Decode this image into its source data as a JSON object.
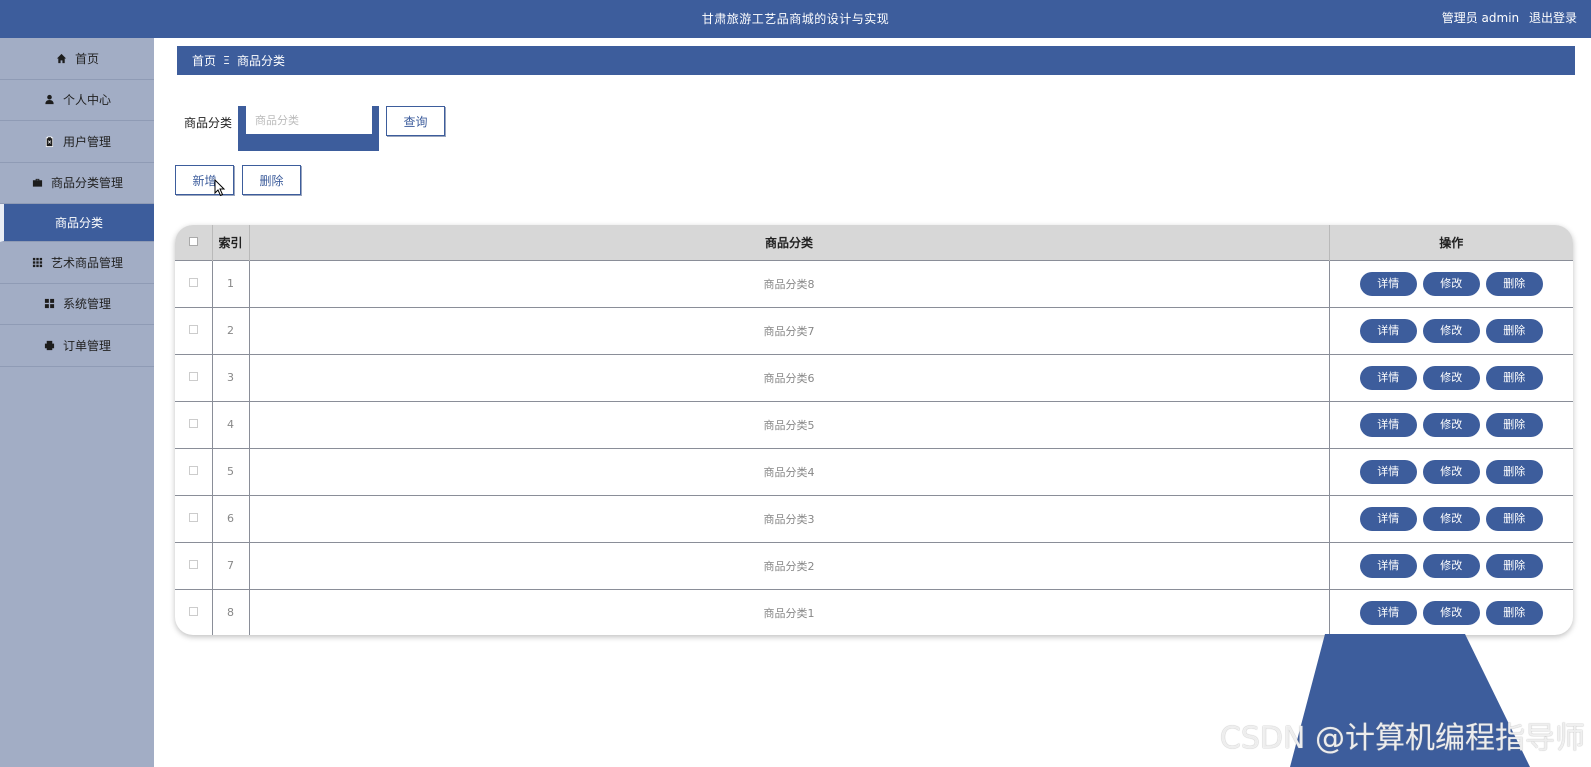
{
  "header": {
    "title": "甘肃旅游工艺品商城的设计与实现",
    "user_label": "管理员 admin",
    "logout_label": "退出登录"
  },
  "sidebar": {
    "items": [
      {
        "label": "首页",
        "icon": "home-icon"
      },
      {
        "label": "个人中心",
        "icon": "user-icon"
      },
      {
        "label": "用户管理",
        "icon": "clipboard-icon"
      },
      {
        "label": "商品分类管理",
        "icon": "briefcase-icon"
      },
      {
        "label": "商品分类",
        "icon": "",
        "active": true
      },
      {
        "label": "艺术商品管理",
        "icon": "grid-icon"
      },
      {
        "label": "系统管理",
        "icon": "apps-icon"
      },
      {
        "label": "订单管理",
        "icon": "print-icon"
      }
    ]
  },
  "breadcrumb": {
    "home": "首页",
    "separator": "Ξ",
    "current": "商品分类"
  },
  "search": {
    "label": "商品分类",
    "placeholder": "商品分类",
    "value": "",
    "query_label": "查询"
  },
  "actions": {
    "add_label": "新增",
    "delete_label": "删除"
  },
  "table": {
    "columns": [
      "",
      "索引",
      "商品分类",
      "操作"
    ],
    "rows": [
      {
        "index": "1",
        "category": "商品分类8"
      },
      {
        "index": "2",
        "category": "商品分类7"
      },
      {
        "index": "3",
        "category": "商品分类6"
      },
      {
        "index": "4",
        "category": "商品分类5"
      },
      {
        "index": "5",
        "category": "商品分类4"
      },
      {
        "index": "6",
        "category": "商品分类3"
      },
      {
        "index": "7",
        "category": "商品分类2"
      },
      {
        "index": "8",
        "category": "商品分类1"
      }
    ],
    "op_labels": {
      "detail": "详情",
      "edit": "修改",
      "delete": "删除"
    }
  },
  "watermark": "CSDN @计算机编程指导师",
  "colors": {
    "primary": "#3d5d9c",
    "sidebar_bg": "#a2adc5",
    "header_row_bg": "#d7d7d7"
  }
}
